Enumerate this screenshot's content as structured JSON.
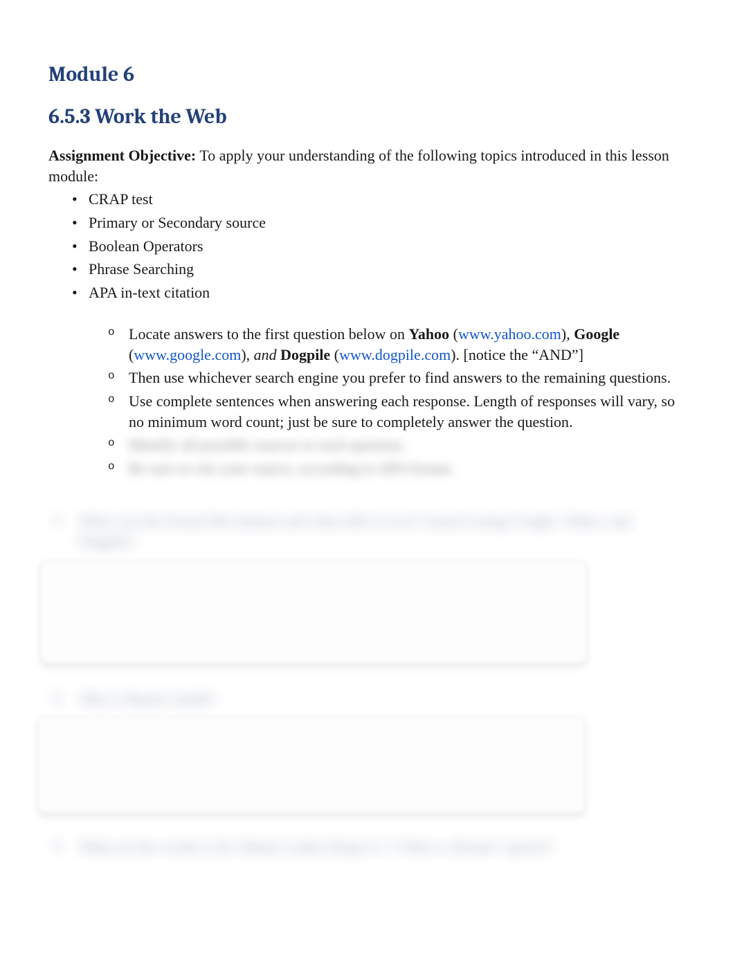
{
  "headings": {
    "module": "Module 6",
    "section": "6.5.3 Work the Web"
  },
  "intro": {
    "label": "Assignment Objective:",
    "text": " To apply your understanding of the following topics introduced in this lesson module:"
  },
  "bullets": [
    "CRAP test",
    "Primary or Secondary source",
    "Boolean Operators",
    "Phrase Searching",
    "APA in-text citation"
  ],
  "sub_items": {
    "item1": {
      "pre": "Locate answers to the first question below on ",
      "yahoo_bold": "Yahoo",
      "yahoo_open": " (",
      "yahoo_link": "www.yahoo.com",
      "yahoo_close": "), ",
      "google_bold": "Google",
      "google_open": " (",
      "google_link": "www.google.com",
      "google_close": "), ",
      "and_italic": "and",
      "space": " ",
      "dogpile_bold": "Dogpile",
      "dogpile_open": " (",
      "dogpile_link": "www.dogpile.com",
      "dogpile_close": ").  [notice the “AND”]"
    },
    "item2": "Then use whichever search engine you prefer to find answers to the remaining questions.",
    "item3": "Use complete sentences when answering each response. Length of responses will vary, so no minimum word count; just be sure to completely answer the question.",
    "item4_blurred": "Identify all possible sources to each question.",
    "item5_blurred": "Be sure to cite your source, according to APA format."
  },
  "questions": {
    "q1_num": "1.",
    "q1_text": "What was the French Revolution and when did it occur? (search using Google, Yahoo, and Dogpile)",
    "q2_num": "2.",
    "q2_text": "Who is Bayete Smith?",
    "q3_num": "3.",
    "q3_text": "What are the words to Dr. Martin Luther King Jr.'s “I Have a Dream” speech?"
  }
}
